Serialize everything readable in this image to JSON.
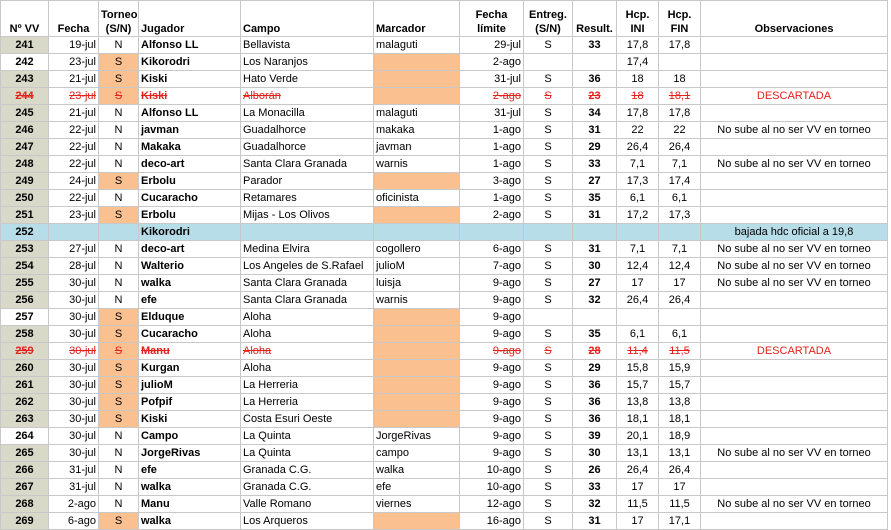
{
  "headers": {
    "nvv": "Nº VV",
    "fecha": "Fecha",
    "torneo": "Torneo\n(S/N)",
    "jugador": "Jugador",
    "campo": "Campo",
    "marcador": "Marcador",
    "fecha_limite": "Fecha\nlímite",
    "entreg": "Entreg.\n(S/N)",
    "result": "Result.",
    "hcp_ini": "Hcp.\nINI",
    "hcp_fin": "Hcp.\nFIN",
    "obs": "Observaciones"
  },
  "colors": {
    "orange": "#fac090",
    "blue": "#b7dde8",
    "gray": "#d9d9c9",
    "strike_red": "#e3221c"
  },
  "rows": [
    {
      "nvv": "241",
      "fecha": "19-jul",
      "torneo": "N",
      "jugador": "Alfonso LL",
      "campo": "Bellavista",
      "marcador": "malaguti",
      "limite": "29-jul",
      "entreg": "S",
      "result": "33",
      "ini": "17,8",
      "fin": "17,8",
      "obs": ""
    },
    {
      "nvv": "242",
      "fecha": "23-jul",
      "torneo": "S",
      "jugador": "Kikorodri",
      "campo": "Los Naranjos",
      "marcador": "",
      "limite": "2-ago",
      "entreg": "",
      "result": "",
      "ini": "17,4",
      "fin": "",
      "obs": ""
    },
    {
      "nvv": "243",
      "fecha": "21-jul",
      "torneo": "S",
      "jugador": "Kiski",
      "campo": "Hato Verde",
      "marcador": "",
      "limite": "31-jul",
      "entreg": "S",
      "result": "36",
      "ini": "18",
      "fin": "18",
      "obs": ""
    },
    {
      "nvv": "244",
      "fecha": "23-jul",
      "torneo": "S",
      "jugador": "Kiski",
      "campo": "Alborán",
      "marcador": "",
      "limite": "2-ago",
      "entreg": "S",
      "result": "23",
      "ini": "18",
      "fin": "18,1",
      "obs": "DESCARTADA"
    },
    {
      "nvv": "245",
      "fecha": "21-jul",
      "torneo": "N",
      "jugador": "Alfonso LL",
      "campo": "La Monacilla",
      "marcador": "malaguti",
      "limite": "31-jul",
      "entreg": "S",
      "result": "34",
      "ini": "17,8",
      "fin": "17,8",
      "obs": ""
    },
    {
      "nvv": "246",
      "fecha": "22-jul",
      "torneo": "N",
      "jugador": "javman",
      "campo": "Guadalhorce",
      "marcador": "makaka",
      "limite": "1-ago",
      "entreg": "S",
      "result": "31",
      "ini": "22",
      "fin": "22",
      "obs": "No sube al no ser VV en torneo"
    },
    {
      "nvv": "247",
      "fecha": "22-jul",
      "torneo": "N",
      "jugador": "Makaka",
      "campo": "Guadalhorce",
      "marcador": "javman",
      "limite": "1-ago",
      "entreg": "S",
      "result": "29",
      "ini": "26,4",
      "fin": "26,4",
      "obs": ""
    },
    {
      "nvv": "248",
      "fecha": "22-jul",
      "torneo": "N",
      "jugador": "deco-art",
      "campo": "Santa Clara Granada",
      "marcador": "warnis",
      "limite": "1-ago",
      "entreg": "S",
      "result": "33",
      "ini": "7,1",
      "fin": "7,1",
      "obs": "No sube al no ser VV en torneo"
    },
    {
      "nvv": "249",
      "fecha": "24-jul",
      "torneo": "S",
      "jugador": "Erbolu",
      "campo": "Parador",
      "marcador": "",
      "limite": "3-ago",
      "entreg": "S",
      "result": "27",
      "ini": "17,3",
      "fin": "17,4",
      "obs": ""
    },
    {
      "nvv": "250",
      "fecha": "22-jul",
      "torneo": "N",
      "jugador": "Cucaracho",
      "campo": "Retamares",
      "marcador": "oficinista",
      "limite": "1-ago",
      "entreg": "S",
      "result": "35",
      "ini": "6,1",
      "fin": "6,1",
      "obs": ""
    },
    {
      "nvv": "251",
      "fecha": "23-jul",
      "torneo": "S",
      "jugador": "Erbolu",
      "campo": "Mijas - Los Olivos",
      "marcador": "",
      "limite": "2-ago",
      "entreg": "S",
      "result": "31",
      "ini": "17,2",
      "fin": "17,3",
      "obs": ""
    },
    {
      "nvv": "252",
      "fecha": "",
      "torneo": "",
      "jugador": "Kikorodri",
      "campo": "",
      "marcador": "",
      "limite": "",
      "entreg": "",
      "result": "",
      "ini": "",
      "fin": "",
      "obs": "bajada hdc oficial a 19,8"
    },
    {
      "nvv": "253",
      "fecha": "27-jul",
      "torneo": "N",
      "jugador": "deco-art",
      "campo": "Medina Elvira",
      "marcador": "cogollero",
      "limite": "6-ago",
      "entreg": "S",
      "result": "31",
      "ini": "7,1",
      "fin": "7,1",
      "obs": "No sube al no ser VV en torneo"
    },
    {
      "nvv": "254",
      "fecha": "28-jul",
      "torneo": "N",
      "jugador": "Walterio",
      "campo": "Los Angeles de S.Rafael",
      "marcador": "julioM",
      "limite": "7-ago",
      "entreg": "S",
      "result": "30",
      "ini": "12,4",
      "fin": "12,4",
      "obs": "No sube al no ser VV en torneo"
    },
    {
      "nvv": "255",
      "fecha": "30-jul",
      "torneo": "N",
      "jugador": "walka",
      "campo": "Santa Clara Granada",
      "marcador": "luisja",
      "limite": "9-ago",
      "entreg": "S",
      "result": "27",
      "ini": "17",
      "fin": "17",
      "obs": "No sube al no ser VV en torneo"
    },
    {
      "nvv": "256",
      "fecha": "30-jul",
      "torneo": "N",
      "jugador": "efe",
      "campo": "Santa Clara Granada",
      "marcador": "warnis",
      "limite": "9-ago",
      "entreg": "S",
      "result": "32",
      "ini": "26,4",
      "fin": "26,4",
      "obs": ""
    },
    {
      "nvv": "257",
      "fecha": "30-jul",
      "torneo": "S",
      "jugador": "Elduque",
      "campo": "Aloha",
      "marcador": "",
      "limite": "9-ago",
      "entreg": "",
      "result": "",
      "ini": "",
      "fin": "",
      "obs": ""
    },
    {
      "nvv": "258",
      "fecha": "30-jul",
      "torneo": "S",
      "jugador": "Cucaracho",
      "campo": "Aloha",
      "marcador": "",
      "limite": "9-ago",
      "entreg": "S",
      "result": "35",
      "ini": "6,1",
      "fin": "6,1",
      "obs": ""
    },
    {
      "nvv": "259",
      "fecha": "30-jul",
      "torneo": "S",
      "jugador": "Manu",
      "campo": "Aloha",
      "marcador": "",
      "limite": "9-ago",
      "entreg": "S",
      "result": "28",
      "ini": "11,4",
      "fin": "11,5",
      "obs": "DESCARTADA"
    },
    {
      "nvv": "260",
      "fecha": "30-jul",
      "torneo": "S",
      "jugador": "Kurgan",
      "campo": "Aloha",
      "marcador": "",
      "limite": "9-ago",
      "entreg": "S",
      "result": "29",
      "ini": "15,8",
      "fin": "15,9",
      "obs": ""
    },
    {
      "nvv": "261",
      "fecha": "30-jul",
      "torneo": "S",
      "jugador": "julioM",
      "campo": "La Herreria",
      "marcador": "",
      "limite": "9-ago",
      "entreg": "S",
      "result": "36",
      "ini": "15,7",
      "fin": "15,7",
      "obs": ""
    },
    {
      "nvv": "262",
      "fecha": "30-jul",
      "torneo": "S",
      "jugador": "Pofpif",
      "campo": "La Herreria",
      "marcador": "",
      "limite": "9-ago",
      "entreg": "S",
      "result": "36",
      "ini": "13,8",
      "fin": "13,8",
      "obs": ""
    },
    {
      "nvv": "263",
      "fecha": "30-jul",
      "torneo": "S",
      "jugador": "Kiski",
      "campo": "Costa Esuri Oeste",
      "marcador": "",
      "limite": "9-ago",
      "entreg": "S",
      "result": "36",
      "ini": "18,1",
      "fin": "18,1",
      "obs": ""
    },
    {
      "nvv": "264",
      "fecha": "30-jul",
      "torneo": "N",
      "jugador": "Campo",
      "campo": "La Quinta",
      "marcador": "JorgeRivas",
      "limite": "9-ago",
      "entreg": "S",
      "result": "39",
      "ini": "20,1",
      "fin": "18,9",
      "obs": ""
    },
    {
      "nvv": "265",
      "fecha": "30-jul",
      "torneo": "N",
      "jugador": "JorgeRivas",
      "campo": "La Quinta",
      "marcador": "campo",
      "limite": "9-ago",
      "entreg": "S",
      "result": "30",
      "ini": "13,1",
      "fin": "13,1",
      "obs": "No sube al no ser VV en torneo"
    },
    {
      "nvv": "266",
      "fecha": "31-jul",
      "torneo": "N",
      "jugador": "efe",
      "campo": "Granada C.G.",
      "marcador": "walka",
      "limite": "10-ago",
      "entreg": "S",
      "result": "26",
      "ini": "26,4",
      "fin": "26,4",
      "obs": ""
    },
    {
      "nvv": "267",
      "fecha": "31-jul",
      "torneo": "N",
      "jugador": "walka",
      "campo": "Granada C.G.",
      "marcador": "efe",
      "limite": "10-ago",
      "entreg": "S",
      "result": "33",
      "ini": "17",
      "fin": "17",
      "obs": ""
    },
    {
      "nvv": "268",
      "fecha": "2-ago",
      "torneo": "N",
      "jugador": "Manu",
      "campo": "Valle Romano",
      "marcador": "viernes",
      "limite": "12-ago",
      "entreg": "S",
      "result": "32",
      "ini": "11,5",
      "fin": "11,5",
      "obs": "No sube al no ser VV en torneo"
    },
    {
      "nvv": "269",
      "fecha": "6-ago",
      "torneo": "S",
      "jugador": "walka",
      "campo": "Los Arqueros",
      "marcador": "",
      "limite": "16-ago",
      "entreg": "S",
      "result": "31",
      "ini": "17",
      "fin": "17,1",
      "obs": ""
    }
  ],
  "row_styles": {
    "strike": [
      "244",
      "259"
    ],
    "blue": [
      "252"
    ],
    "white_nvv": [
      "242",
      "252",
      "257",
      "264"
    ]
  }
}
